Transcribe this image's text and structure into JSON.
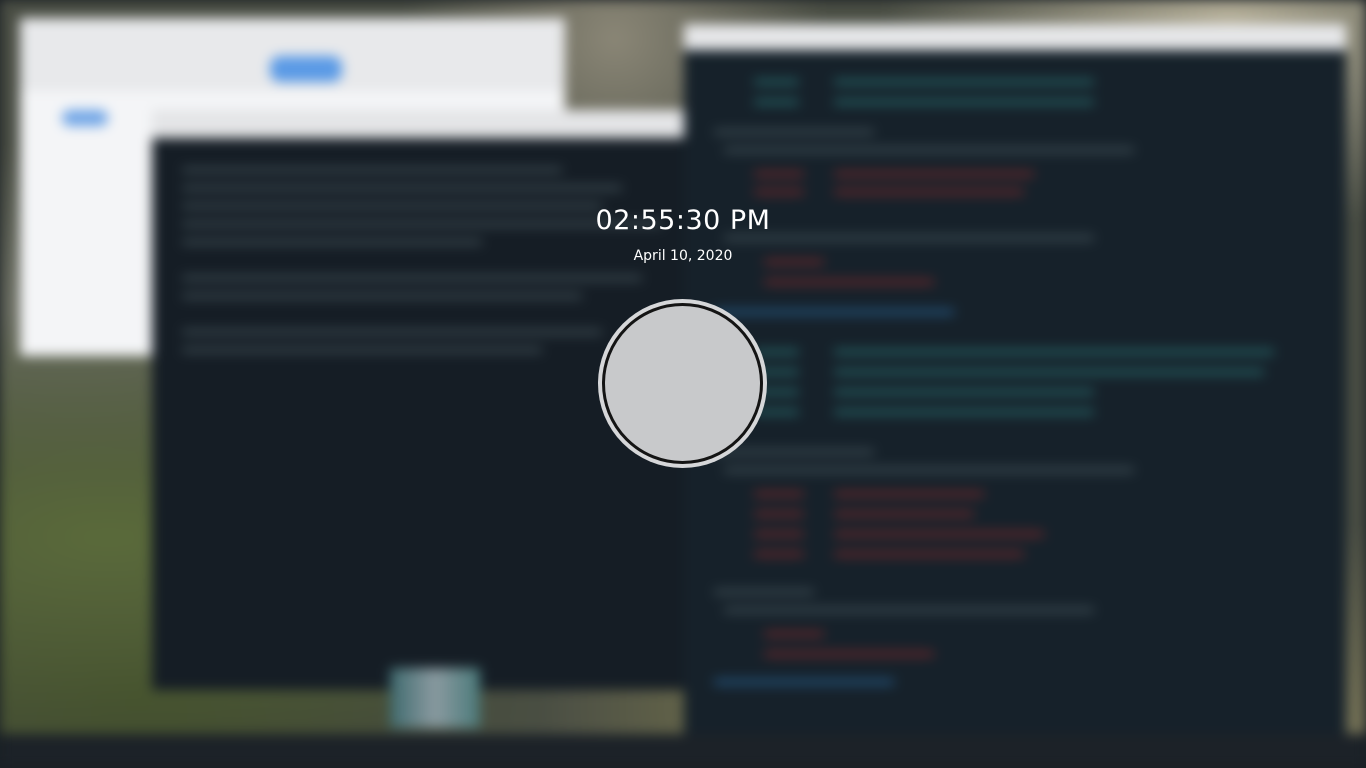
{
  "lock_screen": {
    "time": "02:55:30 PM",
    "date": "April 10, 2020"
  },
  "colors": {
    "text": "#ffffff",
    "ring_outer": "#d6d7d9",
    "ring_inner": "#c8c9cb",
    "ring_border": "#141414",
    "terminal_bg": "#16212a"
  },
  "icons": {
    "unlock": "unlock-circle-icon"
  }
}
